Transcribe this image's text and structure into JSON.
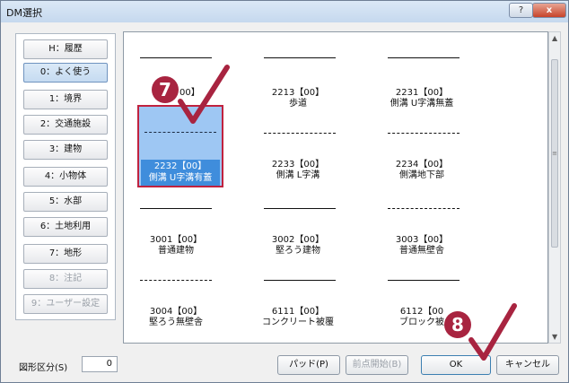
{
  "window": {
    "title": "DM選択",
    "help_glyph": "?",
    "close_glyph": "x"
  },
  "categories": [
    {
      "key": "H",
      "label": "H：履歴",
      "state": "normal"
    },
    {
      "key": "0",
      "label": "0：よく使う",
      "state": "selected"
    },
    {
      "key": "1",
      "label": "1：境界",
      "state": "normal"
    },
    {
      "key": "2",
      "label": "2：交通施設",
      "state": "normal"
    },
    {
      "key": "3",
      "label": "3：建物",
      "state": "normal"
    },
    {
      "key": "4",
      "label": "4：小物体",
      "state": "normal"
    },
    {
      "key": "5",
      "label": "5：水部",
      "state": "normal"
    },
    {
      "key": "6",
      "label": "6：土地利用",
      "state": "normal"
    },
    {
      "key": "7",
      "label": "7：地形",
      "state": "normal"
    },
    {
      "key": "8",
      "label": "8：注記",
      "state": "disabled"
    },
    {
      "key": "9",
      "label": "9：ユーザー設定",
      "state": "disabled"
    }
  ],
  "tiles": [
    {
      "code": "00】",
      "label": "",
      "style": "solid"
    },
    {
      "code": "2213【00】",
      "label": "歩道",
      "style": "solid"
    },
    {
      "code": "2231【00】",
      "label": "側溝 U字溝無蓋",
      "style": "solid"
    },
    {
      "code": "2232【00】",
      "label": "側溝 U字溝有蓋",
      "style": "dashed",
      "selected": true
    },
    {
      "code": "2233【00】",
      "label": "側溝 L字溝",
      "style": "dashed"
    },
    {
      "code": "2234【00】",
      "label": "側溝地下部",
      "style": "dashed"
    },
    {
      "code": "3001【00】",
      "label": "普通建物",
      "style": "solid"
    },
    {
      "code": "3002【00】",
      "label": "堅ろう建物",
      "style": "solid"
    },
    {
      "code": "3003【00】",
      "label": "普通無壁舎",
      "style": "dashed"
    },
    {
      "code": "3004【00】",
      "label": "堅ろう無壁舎",
      "style": "dashed"
    },
    {
      "code": "6111【00】",
      "label": "コンクリート被覆",
      "style": "solid"
    },
    {
      "code": "6112【00",
      "label": "ブロック被",
      "style": "solid"
    }
  ],
  "bottom": {
    "shape_label": "図形区分(S)",
    "shape_value": "0",
    "pad_label": "パッド(P)",
    "prev_label": "前点開始(B)",
    "ok_label": "OK",
    "cancel_label": "キャンセル"
  },
  "callouts": {
    "seven": "7",
    "eight": "8"
  },
  "colors": {
    "selection_fill": "#9ec7f3",
    "selection_label_bg": "#3f8ddc",
    "callout": "#a82440",
    "highlight_border": "#c0223f"
  }
}
